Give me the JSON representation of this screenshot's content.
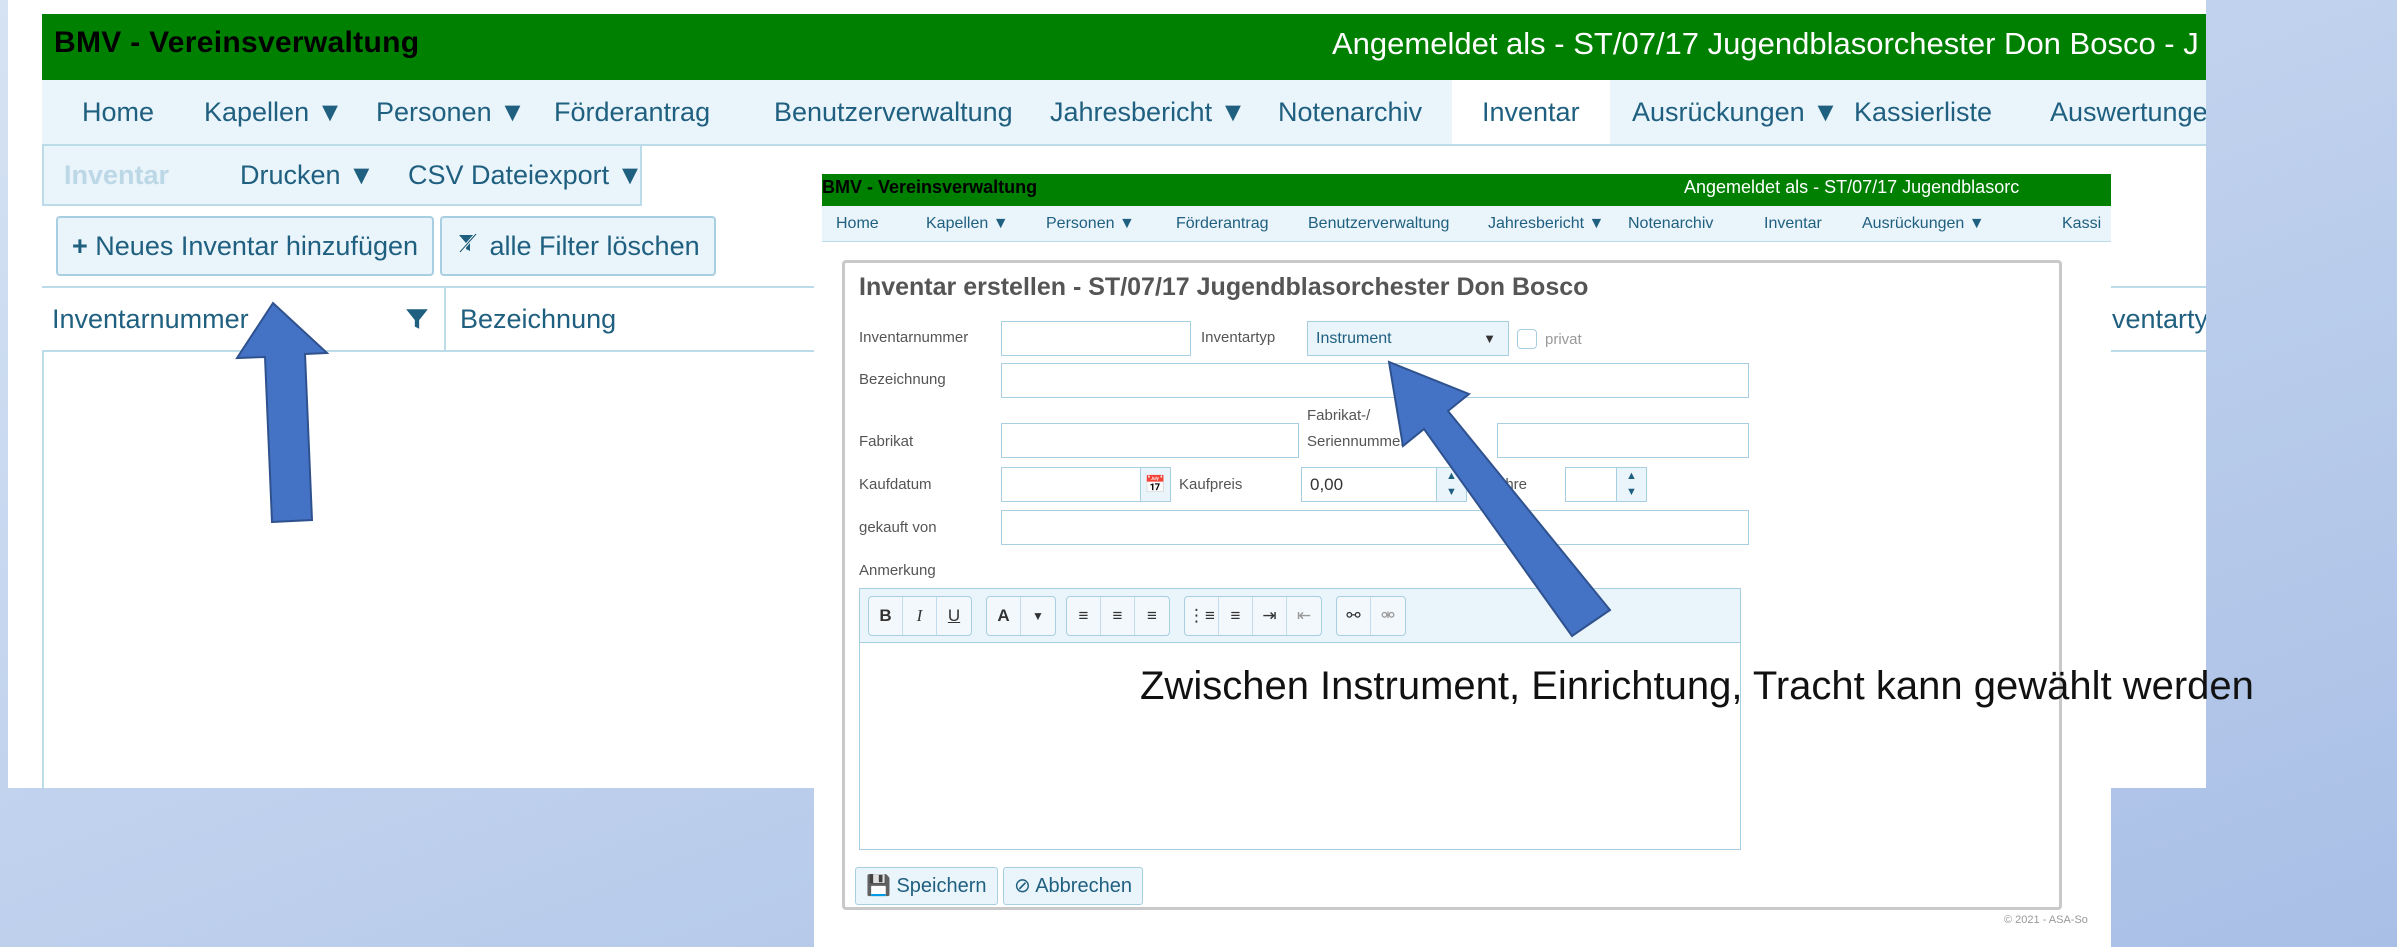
{
  "background_app": {
    "app_title": "BMV - Vereinsverwaltung",
    "login_info": "Angemeldet als - ST/07/17 Jugendblasorchester Don Bosco - J",
    "nav": [
      {
        "label": "Home"
      },
      {
        "label": "Kapellen ▼"
      },
      {
        "label": "Personen ▼"
      },
      {
        "label": "Förderantrag"
      },
      {
        "label": "Benutzerverwaltung"
      },
      {
        "label": "Jahresbericht ▼"
      },
      {
        "label": "Notenarchiv"
      },
      {
        "label": "Inventar"
      },
      {
        "label": "Ausrückungen ▼"
      },
      {
        "label": "Kassierliste"
      },
      {
        "label": "Auswertungen"
      }
    ],
    "subnav": [
      {
        "label": "Inventar"
      },
      {
        "label": "Drucken ▼"
      },
      {
        "label": "CSV Dateiexport ▼"
      }
    ],
    "add_button_label": "Neues Inventar hinzufügen",
    "clear_filter_label": "alle Filter löschen",
    "columns": [
      "Inventarnummer",
      "Bezeichnung",
      "ventartyp"
    ]
  },
  "dialog_app": {
    "app_title": "BMV - Vereinsverwaltung",
    "login_info": "Angemeldet als - ST/07/17 Jugendblasorc",
    "nav": [
      {
        "label": "Home"
      },
      {
        "label": "Kapellen ▼"
      },
      {
        "label": "Personen ▼"
      },
      {
        "label": "Förderantrag"
      },
      {
        "label": "Benutzerverwaltung"
      },
      {
        "label": "Jahresbericht ▼"
      },
      {
        "label": "Notenarchiv"
      },
      {
        "label": "Inventar"
      },
      {
        "label": "Ausrückungen ▼"
      },
      {
        "label": "Kassi"
      }
    ],
    "dialog": {
      "title": "Inventar erstellen - ST/07/17 Jugendblasorchester Don Bosco",
      "labels": {
        "inventarnummer": "Inventarnummer",
        "inventartyp": "Inventartyp",
        "privat": "privat",
        "bezeichnung": "Bezeichnung",
        "fabrikat": "Fabrikat",
        "seriennummer_line1": "Fabrikat-/",
        "seriennummer_line2": "Seriennummer",
        "kaufdatum": "Kaufdatum",
        "kaufpreis": "Kaufpreis",
        "jahre": "ahre",
        "gekauft_von": "gekauft von",
        "anmerkung": "Anmerkung"
      },
      "values": {
        "inventarnummer": "",
        "inventartyp": "Instrument",
        "bezeichnung": "",
        "fabrikat": "",
        "seriennummer": "",
        "kaufdatum": "",
        "kaufpreis": "0,00",
        "jahre": "",
        "gekauft_von": ""
      },
      "toolbar": {
        "bold": "B",
        "italic": "I",
        "underline": "U",
        "font_color": "A"
      },
      "save_label": "Speichern",
      "cancel_label": "Abbrechen"
    },
    "copyright": "© 2021 - ASA-So"
  },
  "annotation": {
    "text": "Zwischen Instrument, Einrichtung, Tracht kann gewählt werden"
  },
  "colors": {
    "header_green": "#008000",
    "nav_bg": "#eaf4fb",
    "nav_text": "#1f5f7f",
    "arrow_fill": "#4472c4",
    "arrow_stroke": "#2f528f"
  }
}
